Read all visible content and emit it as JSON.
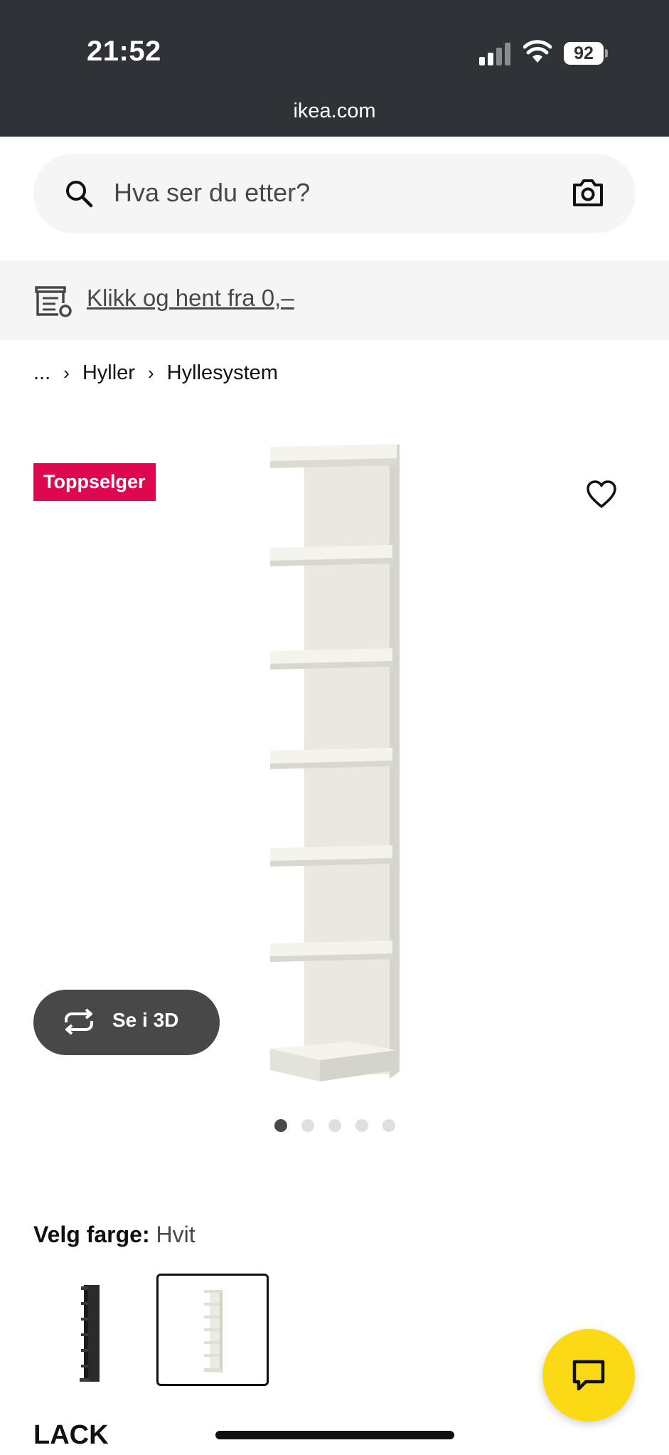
{
  "status_bar": {
    "time": "21:52",
    "battery": "92",
    "url": "ikea.com"
  },
  "search": {
    "placeholder": "Hva ser du etter?",
    "icon": "search-icon",
    "camera_icon": "camera-icon"
  },
  "promo": {
    "icon": "store-icon",
    "link": "Klikk og hent fra 0,–"
  },
  "breadcrumb": {
    "items": [
      "...",
      "Hyller",
      "Hyllesystem"
    ]
  },
  "product": {
    "badge": "Toppselger",
    "view_3d_label": "Se i 3D",
    "image_count": 5,
    "active_image_index": 0,
    "color_label": "Velg farge:",
    "color_value": "Hvit",
    "color_options": [
      "black-brown",
      "white"
    ],
    "selected_color": "white",
    "name": "LACK"
  },
  "colors": {
    "status_bar_bg": "#2f3236",
    "badge_bg": "#e00751",
    "chat_button_bg": "#fbd914",
    "button_3d_bg": "#484848",
    "search_bg": "#f5f5f5"
  }
}
